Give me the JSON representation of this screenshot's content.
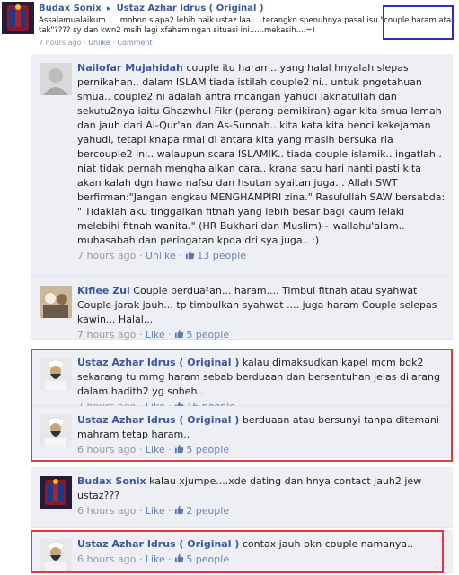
{
  "post": {
    "author": "Budax Sonix",
    "target": "Ustaz Azhar Idrus ( Original )",
    "text": "Assalamualaikum......mohon siapa2 lebih baik ustaz laa.....terangkn spenuhnya pasal isu \"couple haram atau tak\"???? sy dan kwn2 msih lagi xfaham ngan situasi ini......mekasih....=)",
    "time": "7 hours ago",
    "unlike": "Unlike",
    "comment": "Comment",
    "sep": "·"
  },
  "comments": [
    {
      "author": "Nailofar Mujahidah",
      "text": "couple itu haram.. yang halal hnyalah slepas pernikahan.. dalam ISLAM tiada istilah couple2 ni.. untuk pngetahuan smua.. couple2 ni adalah antra rncangan yahudi laknatullah dan sekutu2nya iaitu Ghazwhul Fikr (perang pemikiran) agar kita smua lemah dan jauh dari Al-Qur'an dan As-Sunnah.. kita kata kita benci kekejaman yahudi, tetapi knapa rmai di antara kita yang masih bersuka ria bercouple2 ini.. walaupun scara ISLAMIK.. tiada couple islamik.. ingatlah.. niat tidak pernah menghalalkan cara.. krana satu hari nanti pasti kita akan kalah dgn hawa nafsu dan hsutan syaitan juga... Allah SWT berfirman:\"Jangan engkau MENGHAMPIRI zina.\" Rasulullah SAW bersabda: \" Tidaklah aku tinggalkan fitnah yang lebih besar bagi kaum lelaki melebihi fitnah wanita.\" (HR Bukhari dan Muslim)~ wallahu'alam.. muhasabah dan peringatan kpda dri sya juga.. :)",
      "time": "7 hours ago",
      "action": "Unlike",
      "likes": "13 people"
    },
    {
      "author": "Kiflee Zul",
      "text": "Couple berdua²an... haram.... Timbul fitnah atau syahwat Couple jarak jauh... tp timbulkan syahwat .... juga haram Couple selepas kawin... Halal...",
      "time": "7 hours ago",
      "action": "Like",
      "likes": "5 people"
    },
    {
      "author": "Ustaz Azhar Idrus ( Original )",
      "text": "kalau dimaksudkan kapel mcm bdk2 sekarang tu mmg haram sebab berduaan dan bersentuhan jelas dilarang dalam hadith2 yg soheh..",
      "time": "7 hours ago",
      "action": "Like",
      "likes": "16 people"
    },
    {
      "author": "Ustaz Azhar Idrus ( Original )",
      "text": "berduaan atau bersunyi tanpa ditemani mahram tetap haram..",
      "time": "6 hours ago",
      "action": "Like",
      "likes": "5 people"
    },
    {
      "author": "Budax Sonix",
      "text": "kalau xjumpe....xde dating dan hnya contact jauh2 jew ustaz???",
      "time": "6 hours ago",
      "action": "Like",
      "likes": "2 people"
    },
    {
      "author": "Ustaz Azhar Idrus ( Original )",
      "text": "contax jauh bkn couple namanya..",
      "time": "6 hours ago",
      "action": "Like",
      "likes": "5 people"
    }
  ],
  "colors": {
    "link": "#3b5998",
    "comment_bg": "#edeff4",
    "highlight_blue": "#2b2dc4",
    "highlight_red": "#e03b3b"
  }
}
